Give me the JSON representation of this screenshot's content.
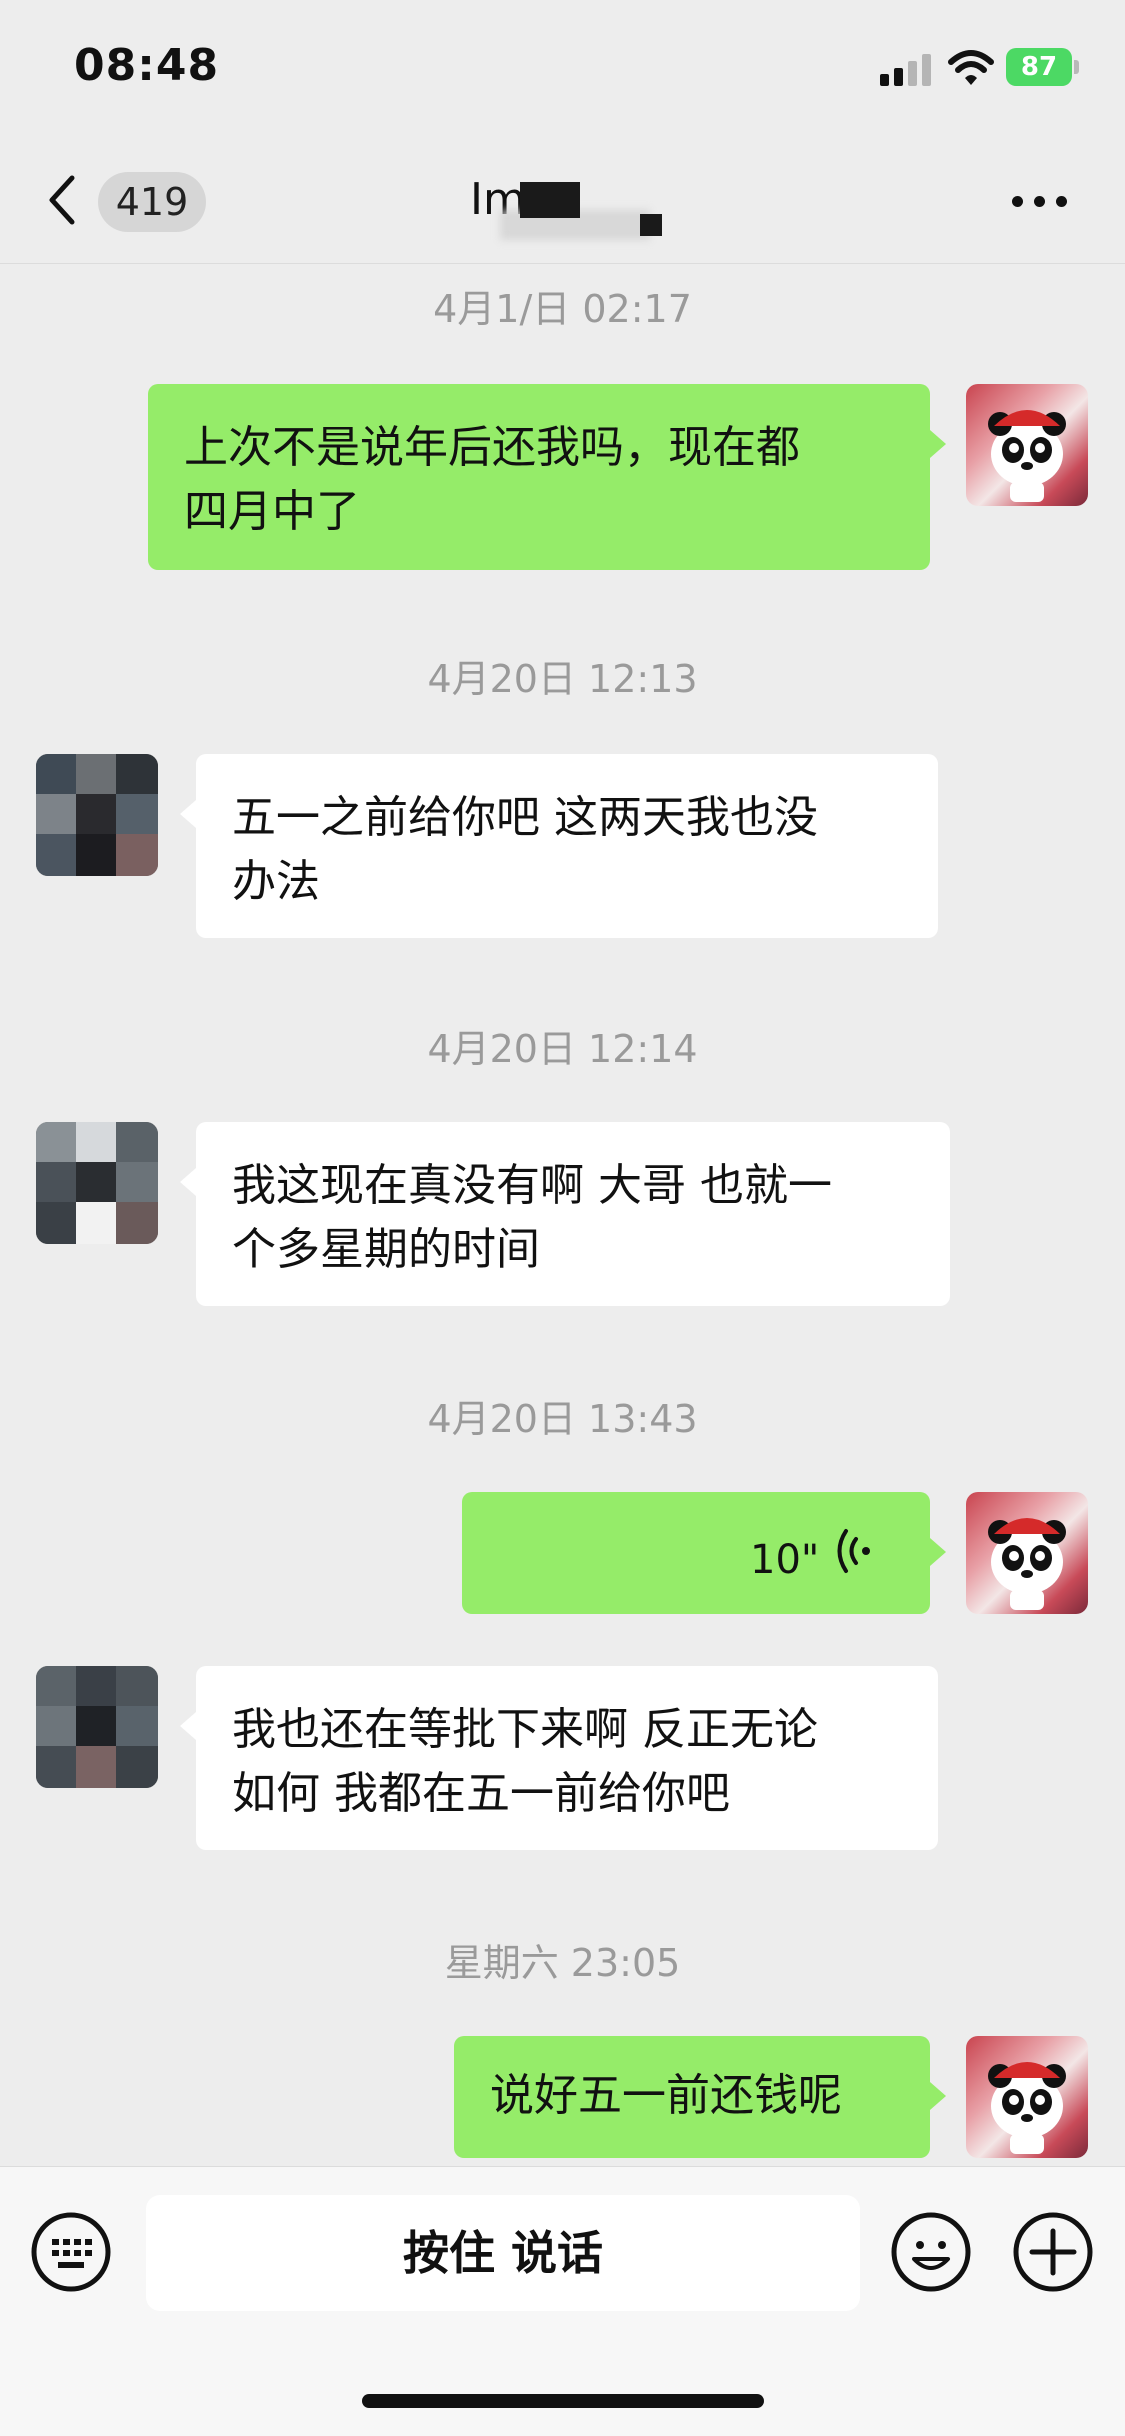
{
  "status_bar": {
    "time": "08:48",
    "battery": "87"
  },
  "header": {
    "unread_count": "419",
    "title": "Im"
  },
  "messages": [
    {
      "type": "timestamp",
      "text": "4月1/日 02:17"
    },
    {
      "type": "text",
      "sender": "me",
      "text": [
        "上次不是说年后还我吗，现在都",
        "四月中了"
      ]
    },
    {
      "type": "timestamp",
      "text": "4月20日 12:13"
    },
    {
      "type": "text",
      "sender": "other",
      "text": [
        "五一之前给你吧 这两天我也没",
        "办法"
      ]
    },
    {
      "type": "timestamp",
      "text": "4月20日 12:14"
    },
    {
      "type": "text",
      "sender": "other",
      "text": [
        "我这现在真没有啊 大哥 也就一",
        "个多星期的时间"
      ]
    },
    {
      "type": "timestamp",
      "text": "4月20日 13:43"
    },
    {
      "type": "voice",
      "sender": "me",
      "duration": "10\""
    },
    {
      "type": "text",
      "sender": "other",
      "text": [
        "我也还在等批下来啊 反正无论",
        "如何 我都在五一前给你吧"
      ]
    },
    {
      "type": "timestamp",
      "text": "星期六 23:05"
    },
    {
      "type": "text",
      "sender": "me",
      "text": [
        "说好五一前还钱呢"
      ]
    }
  ],
  "input_bar": {
    "talk_label": "按住 说话"
  },
  "colors": {
    "bubble_me": "#95ec69",
    "bubble_other": "#ffffff",
    "background": "#ededed"
  },
  "icons": [
    "back-icon",
    "more-icon",
    "voice-wave-icon",
    "keyboard-icon",
    "emoji-icon",
    "plus-icon",
    "wifi-icon",
    "signal-icon",
    "battery-icon"
  ]
}
